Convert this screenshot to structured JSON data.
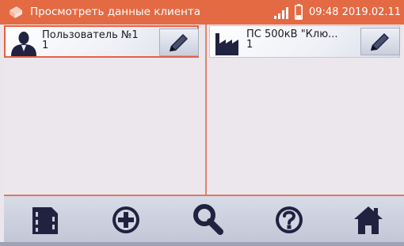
{
  "header": {
    "title": "Просмотреть данные клиента",
    "time": "09:48",
    "date": "2019.02.11",
    "icons": [
      "app-icon",
      "signal-icon",
      "battery-icon"
    ]
  },
  "clients": [
    {
      "name": "Пользователь №1",
      "number": "1",
      "icon": "person-icon",
      "selected": true
    },
    {
      "name": "ПС 500кВ \"Клю...",
      "number": "1",
      "icon": "factory-icon",
      "selected": false
    }
  ],
  "toolbar": {
    "buttons": [
      "memory-card-icon",
      "add-icon",
      "search-icon",
      "help-icon",
      "home-icon"
    ]
  },
  "colors": {
    "accent": "#e46a43",
    "icon": "#1f2340",
    "background": "#eae6ec"
  }
}
